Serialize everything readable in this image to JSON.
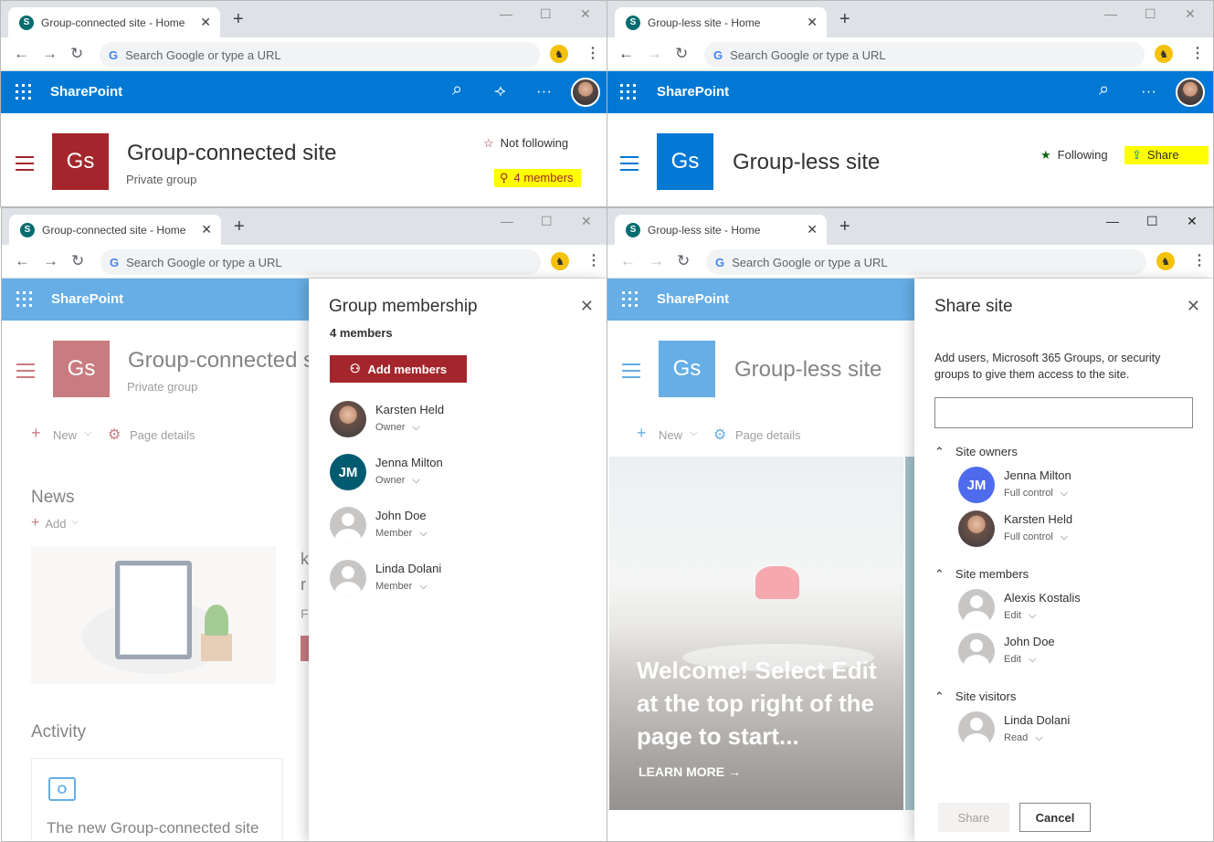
{
  "brand_color": "#0078d4",
  "group_color": "#a4262c",
  "groupless_color": "#0078d4",
  "browser": {
    "search_placeholder": "Search Google or type a URL",
    "new_tab": "+",
    "close_tab": "✕",
    "minimize": "—",
    "maximize": "☐",
    "close_window": "✕",
    "back": "←",
    "forward": "→",
    "reload": "↻",
    "google_g": "G",
    "menu": "⋮"
  },
  "suite": {
    "brand": "SharePoint",
    "search_icon": "⌕",
    "feedback_icon": "⟢",
    "more": "···"
  },
  "top_left": {
    "tab_title": "Group-connected site - Home",
    "logo": "Gs",
    "site_title": "Group-connected site",
    "site_subtitle": "Private group",
    "follow_icon": "☆",
    "follow_label": "Not following",
    "members_icon": "⚲",
    "members_label": "4 members"
  },
  "top_right": {
    "tab_title": "Group-less site - Home",
    "logo": "Gs",
    "site_title": "Group-less site",
    "follow_icon": "★",
    "follow_label": "Following",
    "share_icon": "⇪",
    "share_label": "Share"
  },
  "bottom_left": {
    "tab_title": "Group-connected site - Home",
    "logo": "Gs",
    "site_title": "Group-connected s",
    "site_subtitle": "Private group",
    "cmd_new": "New",
    "cmd_page_details": "Page details",
    "news_heading": "News",
    "news_add": "Add",
    "activity_heading": "Activity",
    "activity_card_text": "The new Group-connected site",
    "partial_letters": [
      "k",
      "r",
      "F"
    ],
    "panel": {
      "title": "Group membership",
      "count": "4 members",
      "add_button": "Add members",
      "add_icon": "⚇",
      "members": [
        {
          "name": "Karsten Held",
          "role": "Owner",
          "avatar": "photo"
        },
        {
          "name": "Jenna Milton",
          "role": "Owner",
          "avatar": "JM"
        },
        {
          "name": "John Doe",
          "role": "Member",
          "avatar": "ghost"
        },
        {
          "name": "Linda Dolani",
          "role": "Member",
          "avatar": "ghost"
        }
      ]
    }
  },
  "bottom_right": {
    "tab_title": "Group-less site - Home",
    "logo": "Gs",
    "site_title": "Group-less site",
    "cmd_new": "New",
    "cmd_page_details": "Page details",
    "hero_text": "Welcome! Select Edit at the top right of the page to start...",
    "hero_link": "LEARN MORE",
    "panel": {
      "title": "Share site",
      "description": "Add users, Microsoft 365 Groups, or security groups to give them access to the site.",
      "input_value": "",
      "sections": [
        {
          "heading": "Site owners",
          "people": [
            {
              "name": "Jenna Milton",
              "role": "Full control",
              "avatar": "JM"
            },
            {
              "name": "Karsten Held",
              "role": "Full control",
              "avatar": "photo"
            }
          ]
        },
        {
          "heading": "Site members",
          "people": [
            {
              "name": "Alexis Kostalis",
              "role": "Edit",
              "avatar": "ghost"
            },
            {
              "name": "John Doe",
              "role": "Edit",
              "avatar": "ghost"
            }
          ]
        },
        {
          "heading": "Site visitors",
          "people": [
            {
              "name": "Linda Dolani",
              "role": "Read",
              "avatar": "ghost"
            }
          ]
        }
      ],
      "share_button": "Share",
      "cancel_button": "Cancel"
    }
  }
}
